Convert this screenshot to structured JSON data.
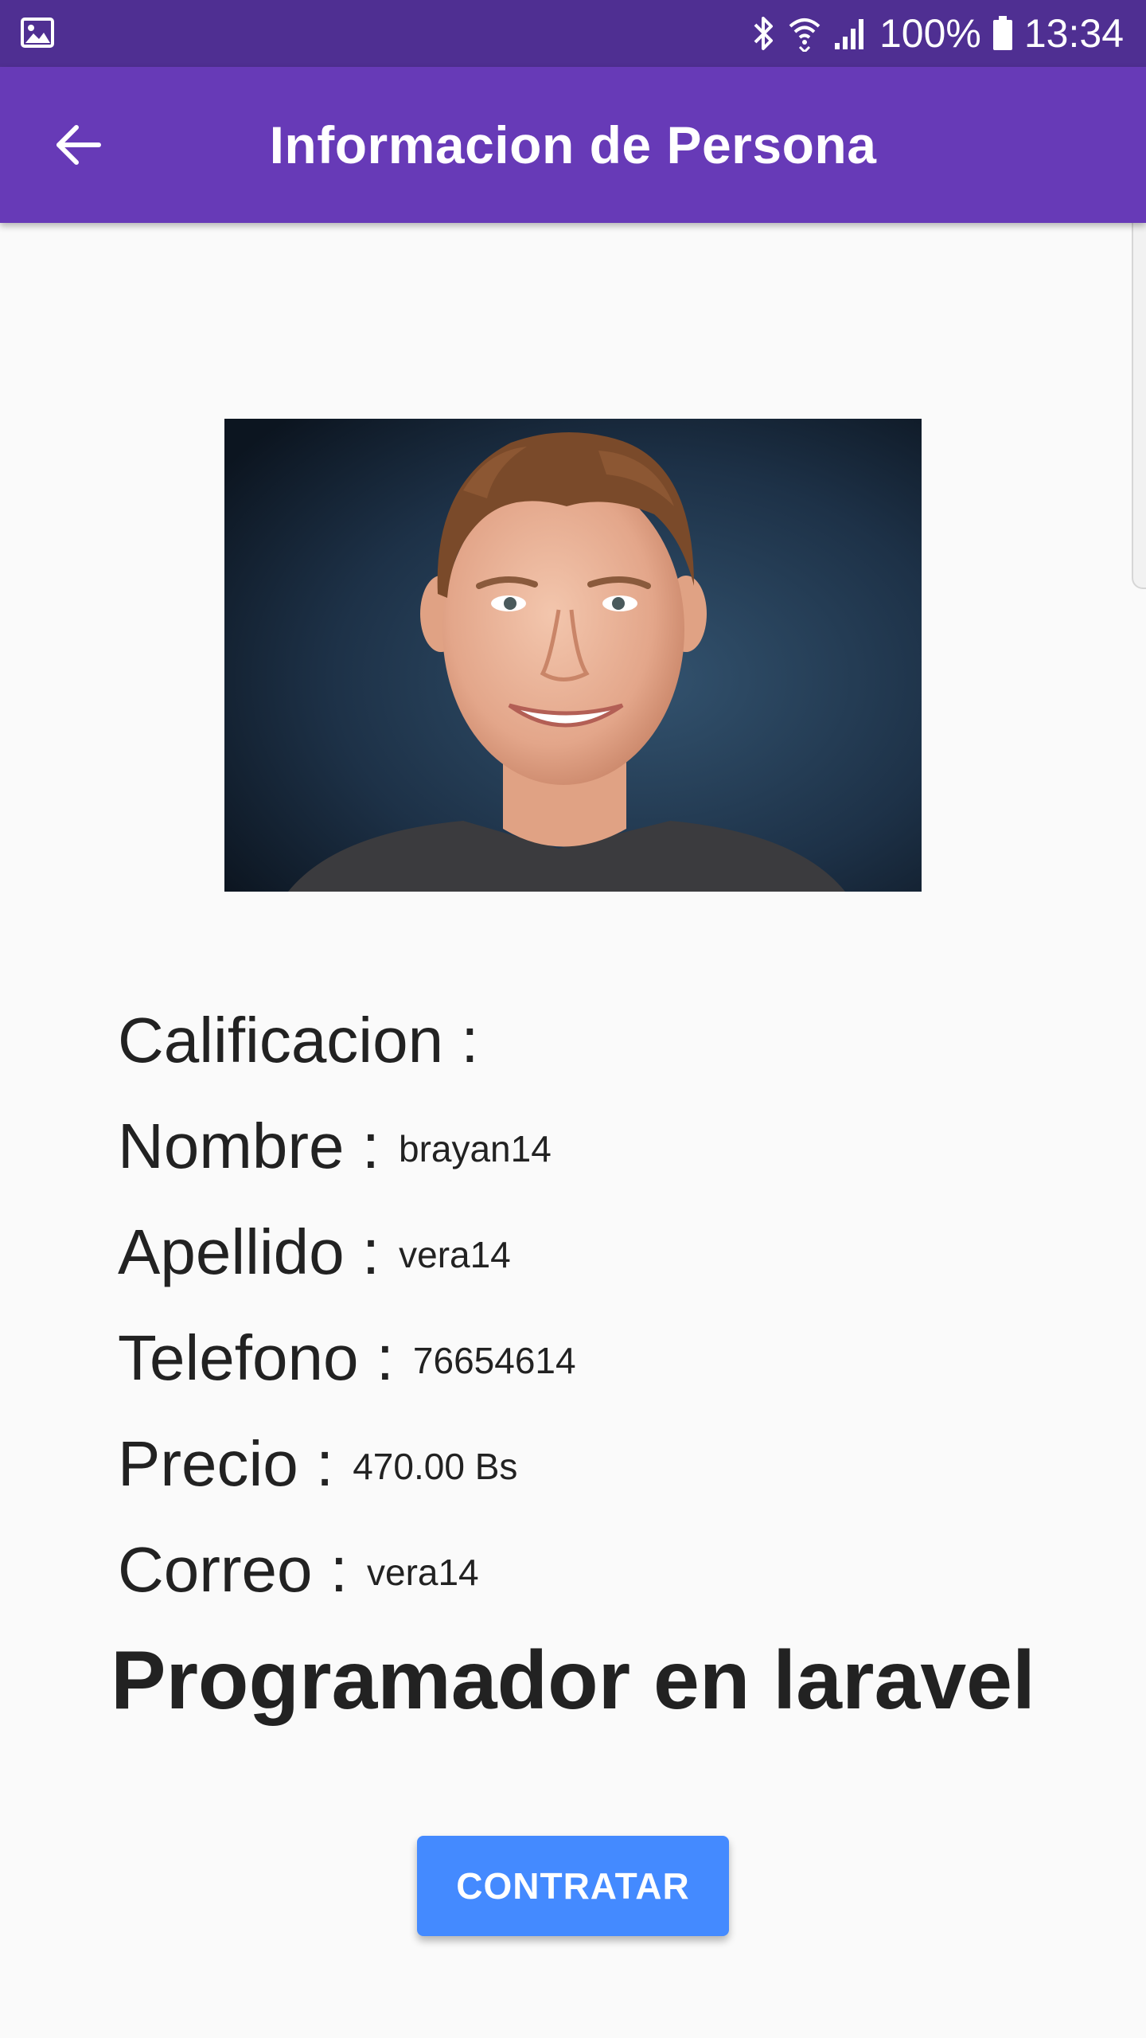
{
  "status_bar": {
    "left_icon": "image-icon",
    "icons": [
      "bluetooth-icon",
      "wifi-icon",
      "signal-icon"
    ],
    "battery_text": "100%",
    "battery_icon": "battery-icon",
    "time": "13:34"
  },
  "app_bar": {
    "back_icon": "arrow-back-icon",
    "title": "Informacion de Persona"
  },
  "profile": {
    "photo_icon": "profile-photo"
  },
  "fields": {
    "calificacion": {
      "label": "Calificacion :",
      "value": ""
    },
    "nombre": {
      "label": "Nombre :",
      "value": "brayan14"
    },
    "apellido": {
      "label": "Apellido :",
      "value": "vera14"
    },
    "telefono": {
      "label": "Telefono :",
      "value": "76654614"
    },
    "precio": {
      "label": "Precio :",
      "value": "470.00 Bs"
    },
    "correo": {
      "label": "Correo :",
      "value": "vera14"
    }
  },
  "job_title": "Programador en laravel",
  "actions": {
    "contratar_label": "CONTRATAR"
  },
  "colors": {
    "status_bar": "#4f2f92",
    "app_bar": "#673ab7",
    "button": "#448aff",
    "background": "#fafafa",
    "text": "#222222"
  }
}
